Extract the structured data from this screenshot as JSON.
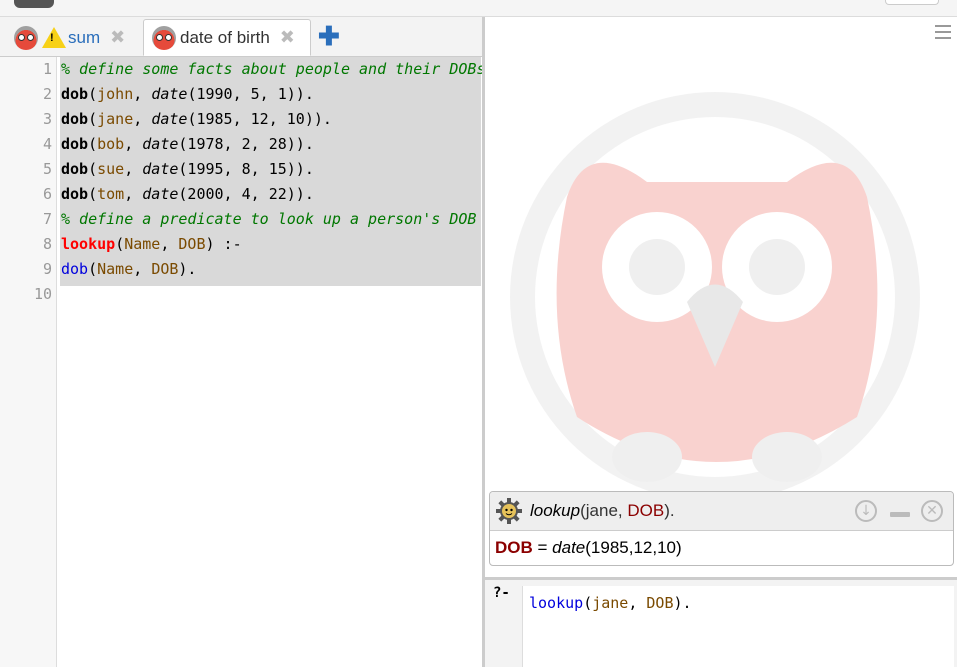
{
  "tabs": [
    {
      "label": "sum",
      "icon": "owl-icon",
      "badge": "warning-icon",
      "close": "✖"
    },
    {
      "label": "date of birth",
      "icon": "owl-icon",
      "close": "✖",
      "active": true
    }
  ],
  "add_tab": "✚",
  "editor": {
    "line_numbers": [
      "1",
      "2",
      "3",
      "4",
      "5",
      "6",
      "7",
      "8",
      "9",
      "10"
    ],
    "lines": [
      [
        {
          "c": "cm",
          "t": "% define some facts about people and their DOBs"
        }
      ],
      [
        {
          "c": "fn",
          "t": "dob"
        },
        {
          "c": "",
          "t": "("
        },
        {
          "c": "at",
          "t": "john"
        },
        {
          "c": "",
          "t": ", "
        },
        {
          "c": "it",
          "t": "date"
        },
        {
          "c": "",
          "t": "(1990, 5, 1))."
        }
      ],
      [
        {
          "c": "fn",
          "t": "dob"
        },
        {
          "c": "",
          "t": "("
        },
        {
          "c": "at",
          "t": "jane"
        },
        {
          "c": "",
          "t": ", "
        },
        {
          "c": "it",
          "t": "date"
        },
        {
          "c": "",
          "t": "(1985, 12, 10))."
        }
      ],
      [
        {
          "c": "fn",
          "t": "dob"
        },
        {
          "c": "",
          "t": "("
        },
        {
          "c": "at",
          "t": "bob"
        },
        {
          "c": "",
          "t": ", "
        },
        {
          "c": "it",
          "t": "date"
        },
        {
          "c": "",
          "t": "(1978, 2, 28))."
        }
      ],
      [
        {
          "c": "fn",
          "t": "dob"
        },
        {
          "c": "",
          "t": "("
        },
        {
          "c": "at",
          "t": "sue"
        },
        {
          "c": "",
          "t": ", "
        },
        {
          "c": "it",
          "t": "date"
        },
        {
          "c": "",
          "t": "(1995, 8, 15))."
        }
      ],
      [
        {
          "c": "fn",
          "t": "dob"
        },
        {
          "c": "",
          "t": "("
        },
        {
          "c": "at",
          "t": "tom"
        },
        {
          "c": "",
          "t": ", "
        },
        {
          "c": "it",
          "t": "date"
        },
        {
          "c": "",
          "t": "(2000, 4, 22))."
        }
      ],
      [
        {
          "c": "cm",
          "t": "% define a predicate to look up a person's DOB"
        }
      ],
      [
        {
          "c": "fnr",
          "t": "lookup"
        },
        {
          "c": "",
          "t": "("
        },
        {
          "c": "var",
          "t": "Name"
        },
        {
          "c": "",
          "t": ", "
        },
        {
          "c": "var",
          "t": "DOB"
        },
        {
          "c": "",
          "t": ") :-"
        }
      ],
      [
        {
          "c": "fnb",
          "t": "dob"
        },
        {
          "c": "",
          "t": "("
        },
        {
          "c": "var",
          "t": "Name"
        },
        {
          "c": "",
          "t": ", "
        },
        {
          "c": "var",
          "t": "DOB"
        },
        {
          "c": "",
          "t": ")."
        }
      ],
      []
    ]
  },
  "answer": {
    "query_pred": "lookup",
    "query_args_prefix": "(jane, ",
    "query_var": "DOB",
    "query_suffix": ").",
    "result_var": "DOB",
    "result_eq": " = ",
    "result_pred": "date",
    "result_args": "(1985,12,10)",
    "controls": [
      "next-icon",
      "minimize-icon",
      "close-icon"
    ]
  },
  "query_prompt": "?-",
  "query_input": [
    {
      "c": "fnb",
      "t": "lookup"
    },
    {
      "c": "",
      "t": "("
    },
    {
      "c": "at",
      "t": "jane"
    },
    {
      "c": "",
      "t": ", "
    },
    {
      "c": "var",
      "t": "DOB"
    },
    {
      "c": "",
      "t": ")."
    }
  ],
  "colors": {
    "accent": "#2a6ebb",
    "comment": "#007700",
    "atom": "#7a4a00",
    "var_result": "#8b0000",
    "selection": "#d9d9d9"
  }
}
